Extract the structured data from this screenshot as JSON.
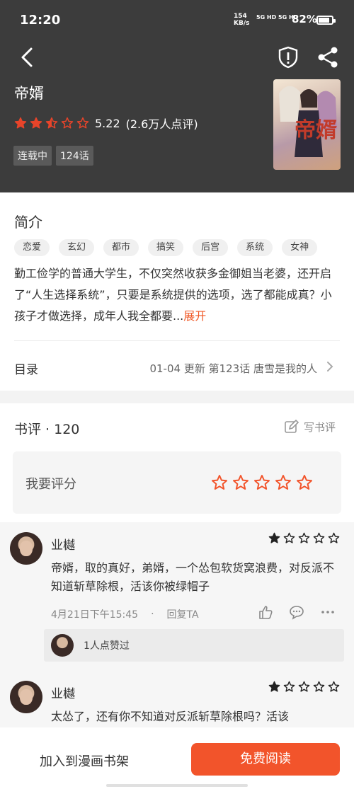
{
  "status_bar": {
    "time": "12:20",
    "net_speed": "154",
    "net_unit": "KB/s",
    "signal": "5G HD 5G HD",
    "battery": "82%",
    "battery_level": 0.82
  },
  "comic": {
    "title": "帝婿",
    "rating": 2.5,
    "score": "5.22",
    "rating_count": "(2.6万人点评)",
    "status_tags": [
      "连载中",
      "124话"
    ],
    "cover_text": "帝婿"
  },
  "intro": {
    "heading": "简介",
    "genre_tags": [
      "恋爱",
      "玄幻",
      "都市",
      "搞笑",
      "后宫",
      "系统",
      "女神"
    ],
    "description": "勤工俭学的普通大学生，不仅突然收获多金御姐当老婆，还开启了“人生选择系统”，只要是系统提供的选项，选了都能成真？小孩子才做选择，成年人我全都要...",
    "expand": "展开",
    "toc_label": "目录",
    "toc_info": "01-04  更新  第123话 唐雪是我的人"
  },
  "reviews": {
    "heading": "书评 · 120",
    "write_label": "写书评",
    "rate_label": "我要评分",
    "rate_value": 0
  },
  "comments": [
    {
      "user": "业樾",
      "stars": 1,
      "text": "帝婿，取的真好，弟婿，一个怂包软货窝浪费，对反派不知道斩草除根，活该你被绿帽子",
      "time": "4月21日下午15:45",
      "reply": "回复TA",
      "likes_text": "1人点赞过"
    },
    {
      "user": "业樾",
      "stars": 1,
      "text": "太怂了，还有你不知道对反派斩草除根吗？活该"
    }
  ],
  "bottom_bar": {
    "add_shelf": "加入到漫画书架",
    "read_free": "免费阅读"
  },
  "colors": {
    "accent": "#f2542b",
    "star": "#e8442a",
    "header_bg": "#3c3c3c"
  }
}
